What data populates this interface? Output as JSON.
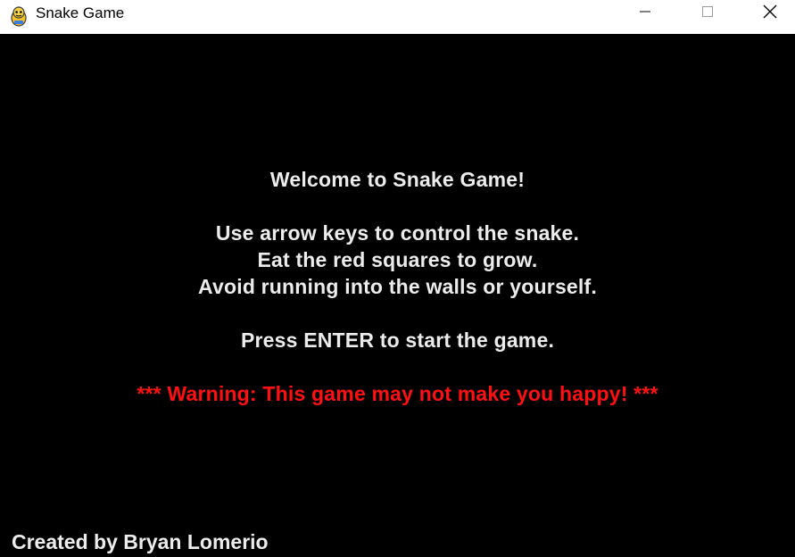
{
  "window": {
    "title": "Snake Game",
    "icon": "pygame-snake-icon",
    "controls": {
      "minimize": "minimize-icon",
      "maximize": "maximize-icon",
      "close": "close-icon"
    }
  },
  "screen": {
    "heading": "Welcome to Snake Game!",
    "instructions": [
      "Use arrow keys to control the snake.",
      "Eat the red squares to grow.",
      "Avoid running into the walls or yourself."
    ],
    "prompt": "Press ENTER to start the game.",
    "warning": "*** Warning: This game may not make you happy! ***",
    "credit": "Created by Bryan Lomerio"
  },
  "colors": {
    "background": "#000000",
    "text": "#ececec",
    "warning": "#ff1010",
    "titlebar": "#ffffff"
  }
}
